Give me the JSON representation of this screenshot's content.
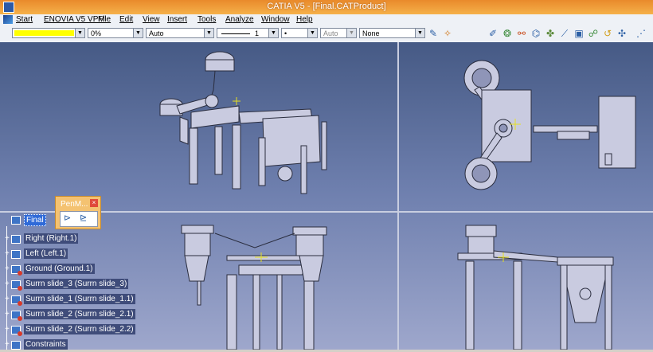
{
  "window": {
    "title": "CATIA V5 - [Final.CATProduct]"
  },
  "menu": [
    {
      "label": "Start"
    },
    {
      "label": "ENOVIA V5 VPM"
    },
    {
      "label": "File"
    },
    {
      "label": "Edit"
    },
    {
      "label": "View"
    },
    {
      "label": "Insert"
    },
    {
      "label": "Tools"
    },
    {
      "label": "Analyze"
    },
    {
      "label": "Window"
    },
    {
      "label": "Help"
    }
  ],
  "toolbar": {
    "color_value": "",
    "transparency_value": "0%",
    "linewidth_value": "Auto",
    "linetype_value": "1",
    "point_value": "•",
    "layer_auto_value": "Auto",
    "layer_value": "None",
    "accent_yellow": "#ffff00"
  },
  "pen_panel": {
    "title": "PenM...",
    "close": "×"
  },
  "tree": [
    {
      "label": "Final",
      "root": true
    },
    {
      "label": "Right (Right.1)"
    },
    {
      "label": "Left (Left.1)"
    },
    {
      "label": "Ground (Ground.1)"
    },
    {
      "label": "Surrn slide_3 (Surrn slide_3)"
    },
    {
      "label": "Surrn slide_1 (Surrn slide_1.1)"
    },
    {
      "label": "Surrn slide_2 (Surrn slide_2.1)"
    },
    {
      "label": "Surrn slide_2 (Surrn slide_2.2)"
    },
    {
      "label": "Constraints"
    }
  ],
  "icons": [
    "catia-app-icon",
    "start-icon",
    "paint-icon",
    "sketch-icon",
    "assembly-icons",
    "close-icon",
    "pen-icons",
    "product-icon",
    "part-icon"
  ]
}
